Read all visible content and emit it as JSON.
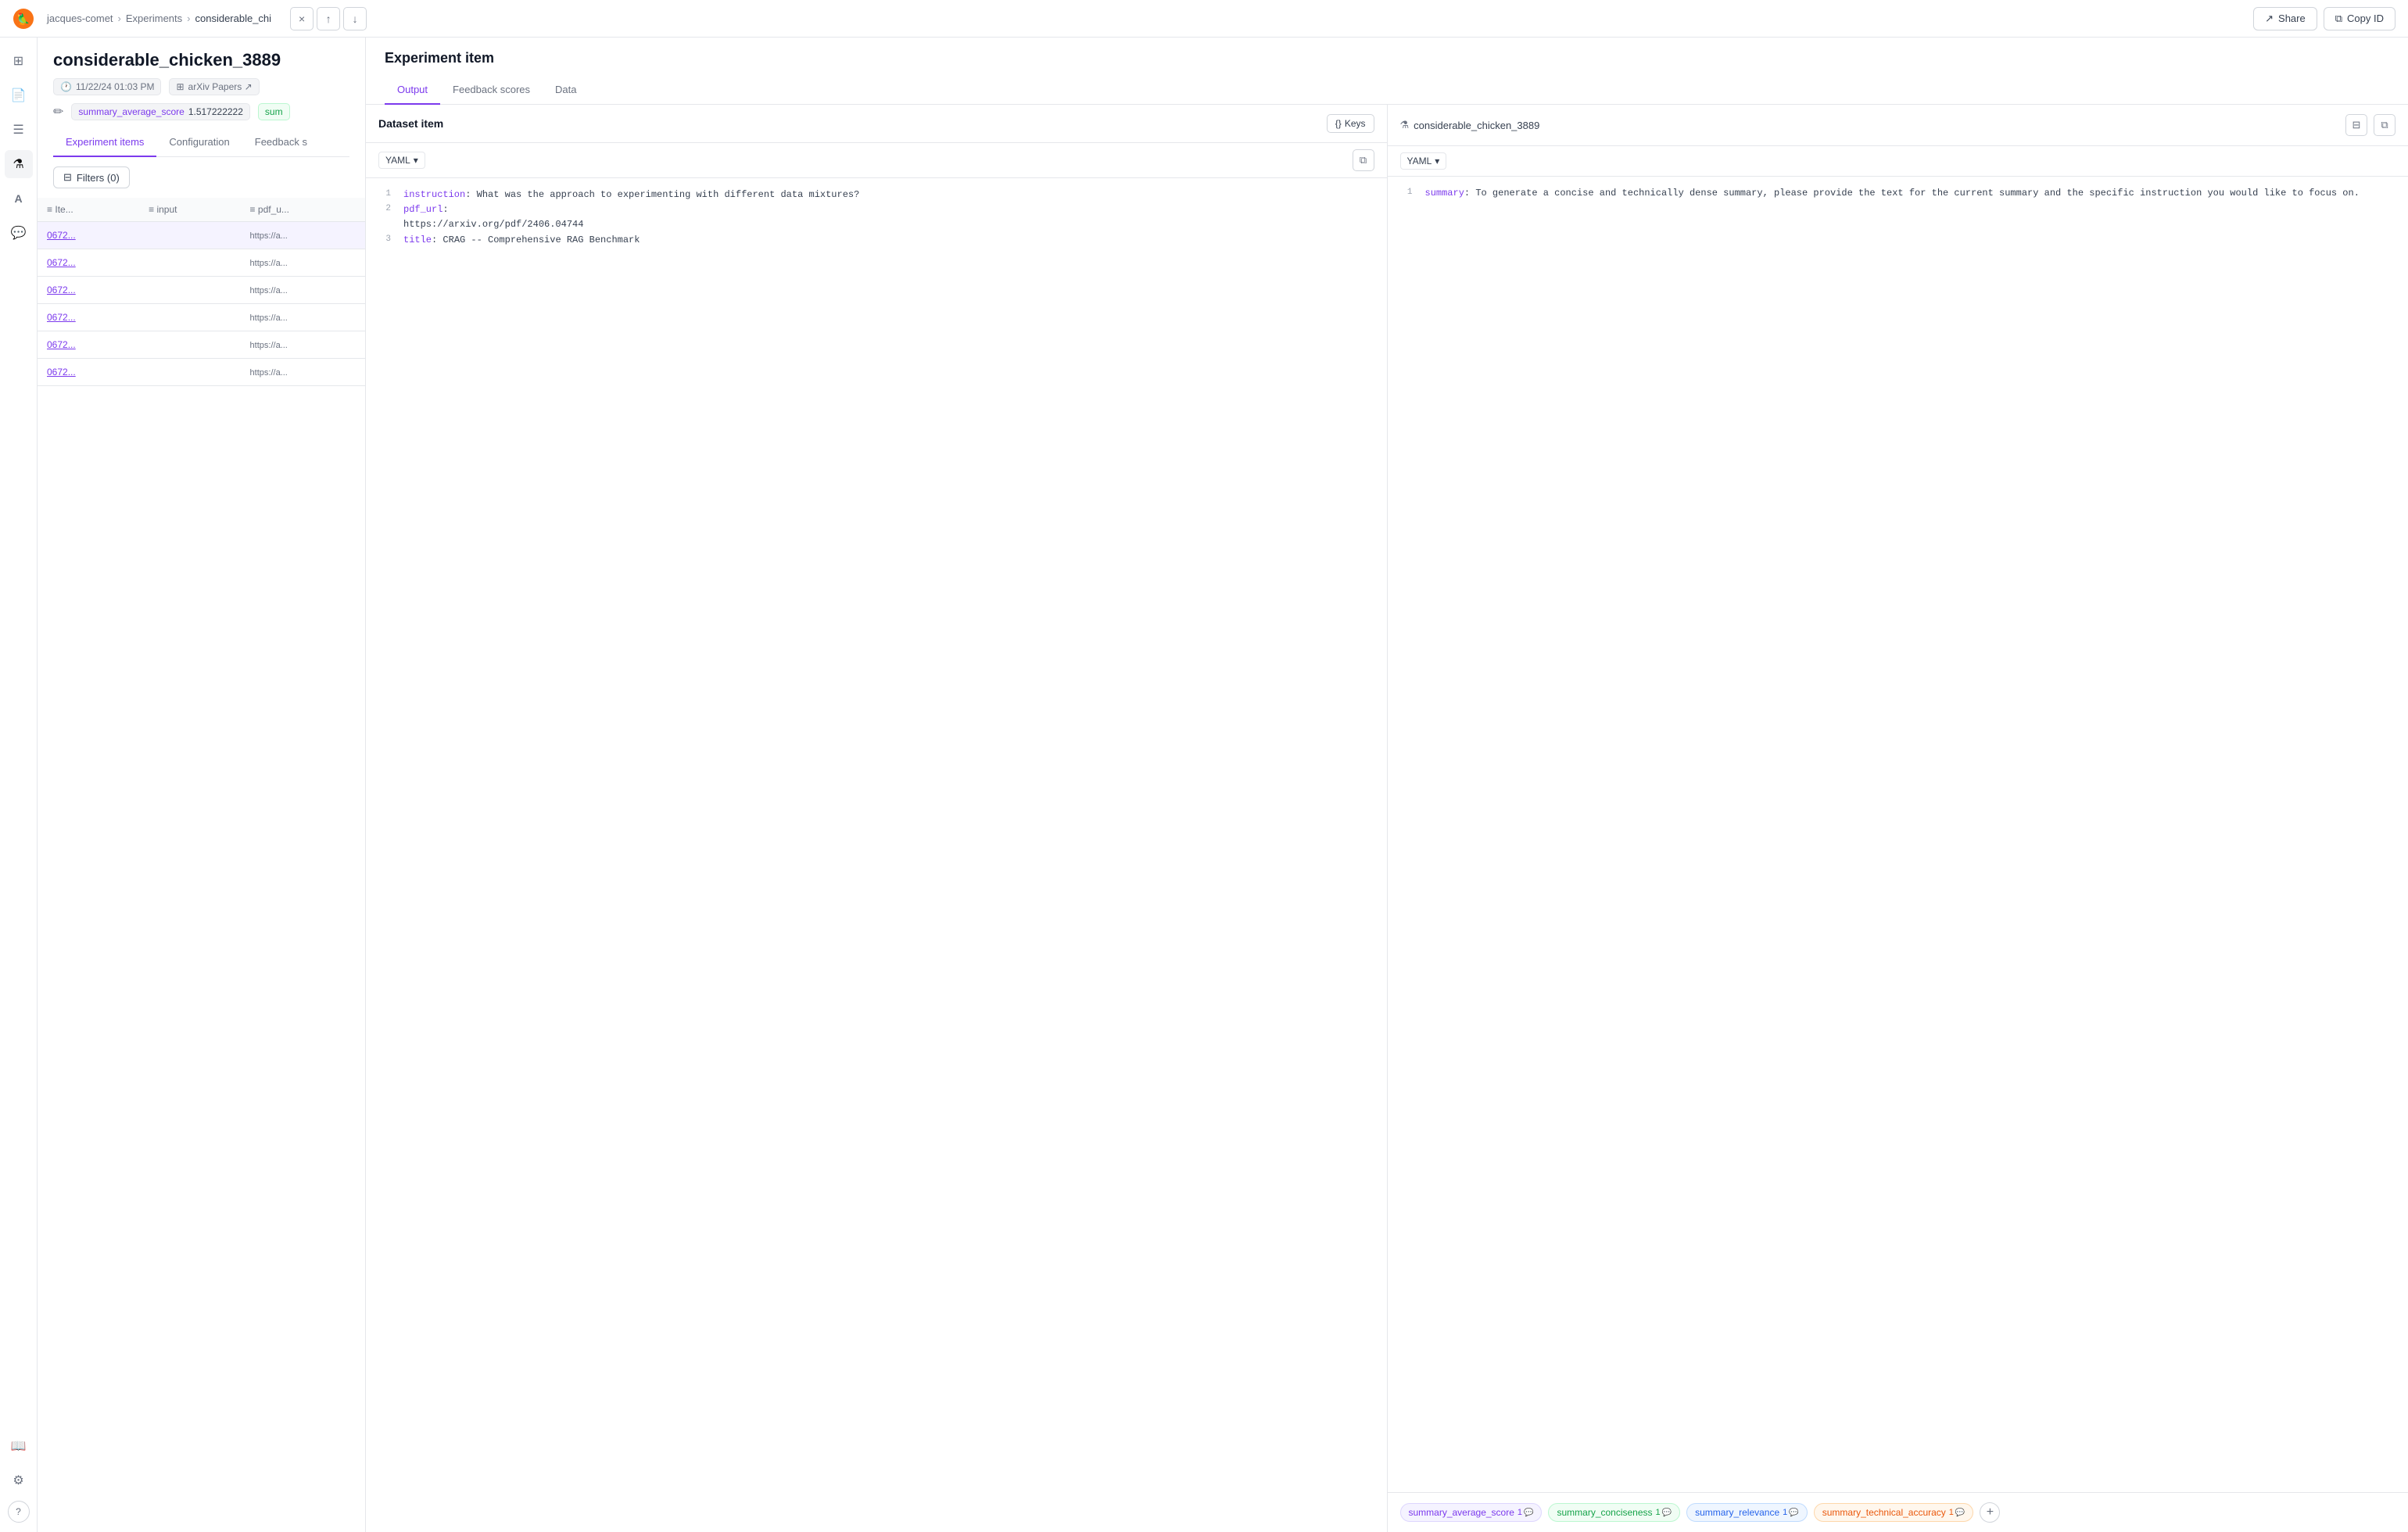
{
  "topbar": {
    "breadcrumb": {
      "workspace": "jacques-comet",
      "section": "Experiments",
      "current": "considerable_chi"
    },
    "share_label": "Share",
    "copy_id_label": "Copy ID"
  },
  "panel_nav": {
    "close_label": "×",
    "up_label": "↑",
    "down_label": "↓"
  },
  "left_panel": {
    "title": "considerable_chicken_3889",
    "meta": {
      "date": "11/22/24 01:03 PM",
      "source": "arXiv Papers ↗"
    },
    "score_key": "summary_average_score",
    "score_val": "1.517222222",
    "sum_label": "sum",
    "tabs": [
      "Experiment items",
      "Configuration",
      "Feedback s"
    ],
    "active_tab": "Experiment items",
    "filter_label": "Filters (0)",
    "table": {
      "headers": [
        "Ite...",
        "input",
        "pdf_u..."
      ],
      "rows": [
        {
          "id": "0672...",
          "input": "",
          "pdf_url": "https://a..."
        },
        {
          "id": "0672...",
          "input": "",
          "pdf_url": "https://a..."
        },
        {
          "id": "0672...",
          "input": "",
          "pdf_url": "https://a..."
        },
        {
          "id": "0672...",
          "input": "",
          "pdf_url": "https://a..."
        },
        {
          "id": "0672...",
          "input": "",
          "pdf_url": "https://a..."
        },
        {
          "id": "0672...",
          "input": "",
          "pdf_url": "https://a..."
        }
      ]
    }
  },
  "right_panel": {
    "title": "Experiment item",
    "tabs": [
      "Output",
      "Feedback scores",
      "Data"
    ],
    "active_tab": "Output",
    "dataset_section": {
      "title": "Dataset item",
      "keys_label": "Keys",
      "format": "YAML",
      "lines": [
        {
          "num": 1,
          "key": "instruction",
          "value": ": What was the approach to experimenting with different data mixtures?"
        },
        {
          "num": 2,
          "key": "pdf_url",
          "value": ":\nhttps://arxiv.org/pdf/2406.04744"
        },
        {
          "num": 3,
          "key": "title",
          "value": ": CRAG -- Comprehensive RAG Benchmark"
        }
      ]
    },
    "experiment_section": {
      "name": "considerable_chicken_3889",
      "format": "YAML",
      "lines": [
        {
          "num": 1,
          "key": "summary",
          "value": ": To generate a concise and technically dense summary, please provide the text for the current summary and the specific instruction you would like to focus on."
        }
      ],
      "feedback_tags": [
        {
          "key": "summary_average_score",
          "count": "1",
          "type": "purple"
        },
        {
          "key": "summary_conciseness",
          "count": "1",
          "type": "green"
        },
        {
          "key": "summary_relevance",
          "count": "1",
          "type": "blue"
        },
        {
          "key": "summary_technical_accuracy",
          "count": "1",
          "type": "orange"
        }
      ]
    }
  },
  "sidebar": {
    "icons": [
      {
        "name": "home",
        "symbol": "⊞",
        "active": false
      },
      {
        "name": "document",
        "symbol": "📄",
        "active": false
      },
      {
        "name": "list",
        "symbol": "☰",
        "active": false
      },
      {
        "name": "flask",
        "symbol": "⚗",
        "active": true
      },
      {
        "name": "text",
        "symbol": "A",
        "active": false
      },
      {
        "name": "comment",
        "symbol": "💬",
        "active": false
      }
    ],
    "bottom_icons": [
      {
        "name": "book",
        "symbol": "📖"
      },
      {
        "name": "settings",
        "symbol": "⚙"
      },
      {
        "name": "help",
        "symbol": "?"
      }
    ]
  },
  "colors": {
    "accent": "#7c3aed",
    "border": "#e5e7eb",
    "bg_subtle": "#f9fafb"
  }
}
